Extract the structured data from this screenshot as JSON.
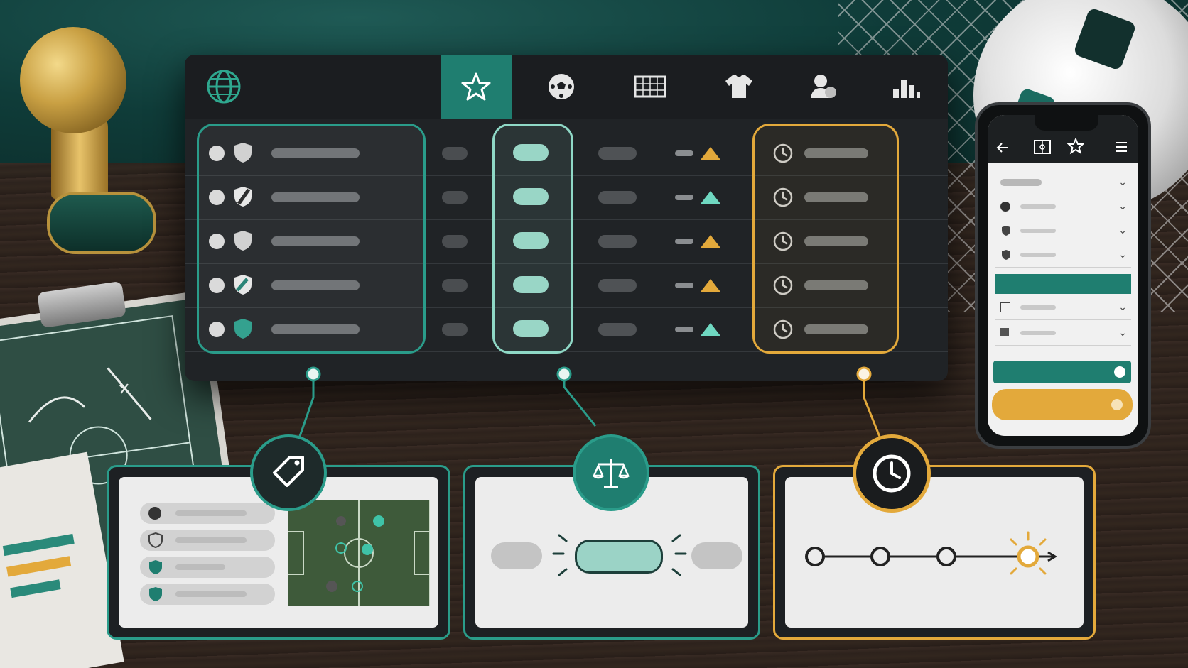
{
  "nav": {
    "items": [
      {
        "icon": "globe-icon"
      },
      {
        "icon": "star-icon",
        "active": true
      },
      {
        "icon": "soccer-ball-icon"
      },
      {
        "icon": "goal-icon"
      },
      {
        "icon": "jersey-icon"
      },
      {
        "icon": "player-icon"
      },
      {
        "icon": "bar-chart-icon"
      }
    ]
  },
  "rows": [
    {
      "trend": "up",
      "trend_color": "#e3a93b"
    },
    {
      "trend": "up",
      "trend_color": "#6fd8c1"
    },
    {
      "trend": "up",
      "trend_color": "#e3a93b"
    },
    {
      "trend": "up",
      "trend_color": "#e3a93b"
    },
    {
      "trend": "up",
      "trend_color": "#6fd8c1"
    }
  ],
  "colors": {
    "teal": "#1f7e70",
    "mint": "#8fd8c6",
    "gold": "#e3a93b",
    "panel": "#202326"
  },
  "callouts": [
    {
      "icon": "tag-icon",
      "accent": "#2a9c8a"
    },
    {
      "icon": "scale-icon",
      "accent": "#2a9c8a"
    },
    {
      "icon": "clock-icon",
      "accent": "#e3a93b"
    }
  ],
  "phone": {
    "icons": [
      "back-arrow-icon",
      "pitch-icon",
      "star-icon",
      "menu-icon"
    ]
  }
}
